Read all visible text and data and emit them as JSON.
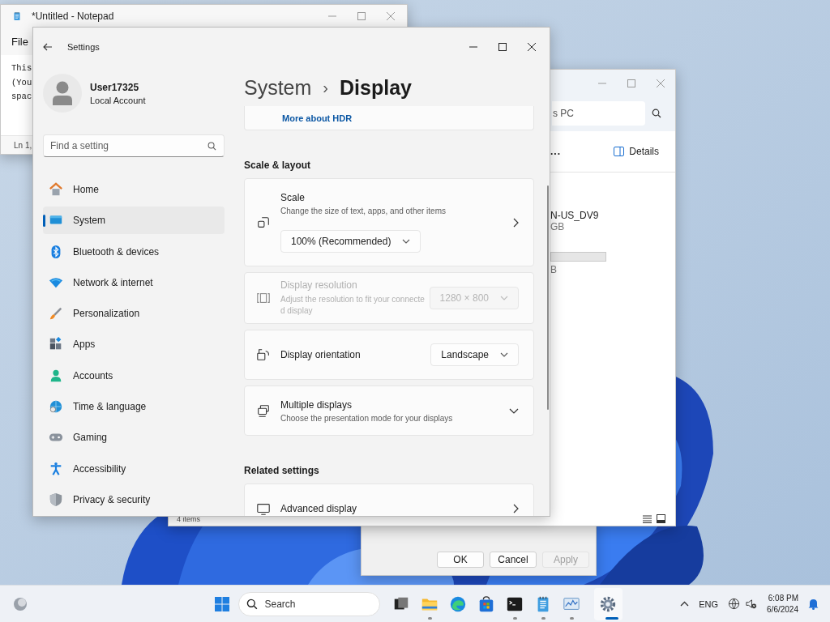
{
  "notepad": {
    "title": "*Untitled - Notepad",
    "menu": [
      "File"
    ],
    "lines": [
      "This",
      "(You",
      "spac"
    ],
    "status": "Ln 1,"
  },
  "dialog": {
    "buttons": [
      {
        "label": "OK",
        "disabled": false
      },
      {
        "label": "Cancel",
        "disabled": false
      },
      {
        "label": "Apply",
        "disabled": true
      }
    ]
  },
  "explorer": {
    "address": "s PC",
    "more": "...",
    "details": "Details",
    "drive": {
      "name": "N-US_DV9",
      "size": "GB",
      "free": "B"
    },
    "status": "4 items"
  },
  "settings": {
    "title": "Settings",
    "user": {
      "name": "User17325",
      "account": "Local Account"
    },
    "search": {
      "placeholder": "Find a setting"
    },
    "nav": [
      {
        "label": "Home",
        "selected": false
      },
      {
        "label": "System",
        "selected": true
      },
      {
        "label": "Bluetooth & devices",
        "selected": false
      },
      {
        "label": "Network & internet",
        "selected": false
      },
      {
        "label": "Personalization",
        "selected": false
      },
      {
        "label": "Apps",
        "selected": false
      },
      {
        "label": "Accounts",
        "selected": false
      },
      {
        "label": "Time & language",
        "selected": false
      },
      {
        "label": "Gaming",
        "selected": false
      },
      {
        "label": "Accessibility",
        "selected": false
      },
      {
        "label": "Privacy & security",
        "selected": false
      }
    ],
    "breadcrumb": {
      "parent": "System",
      "separator": "›",
      "current": "Display"
    },
    "content": [
      {
        "kind": "link",
        "text": "More about HDR"
      },
      {
        "kind": "heading",
        "text": "Scale & layout"
      },
      {
        "kind": "stacked",
        "title": "Scale",
        "description": "Change the size of text, apps, and other items",
        "value": "100% (Recommended)",
        "disabled": false
      },
      {
        "kind": "dropdown",
        "title": "Display resolution",
        "description": "Adjust the resolution to fit your connected display",
        "value": "1280 × 800",
        "disabled": true
      },
      {
        "kind": "dropdown",
        "title": "Display orientation",
        "value": "Landscape",
        "disabled": false
      },
      {
        "kind": "expander",
        "title": "Multiple displays",
        "description": "Choose the presentation mode for your displays",
        "disabled": false
      },
      {
        "kind": "heading",
        "text": "Related settings"
      },
      {
        "kind": "navigation",
        "title": "Advanced display",
        "disabled": false
      }
    ]
  },
  "taskbar": {
    "search": {
      "placeholder": "Search"
    },
    "apps": [
      {
        "running": false,
        "active": false
      },
      {
        "running": true,
        "active": false
      },
      {
        "running": false,
        "active": false
      },
      {
        "running": false,
        "active": false
      },
      {
        "running": true,
        "active": false
      },
      {
        "running": true,
        "active": false
      },
      {
        "running": true,
        "active": false
      },
      {
        "running": true,
        "active": true
      }
    ],
    "language": "ENG",
    "time": "6:08 PM",
    "date": "6/6/2024"
  }
}
